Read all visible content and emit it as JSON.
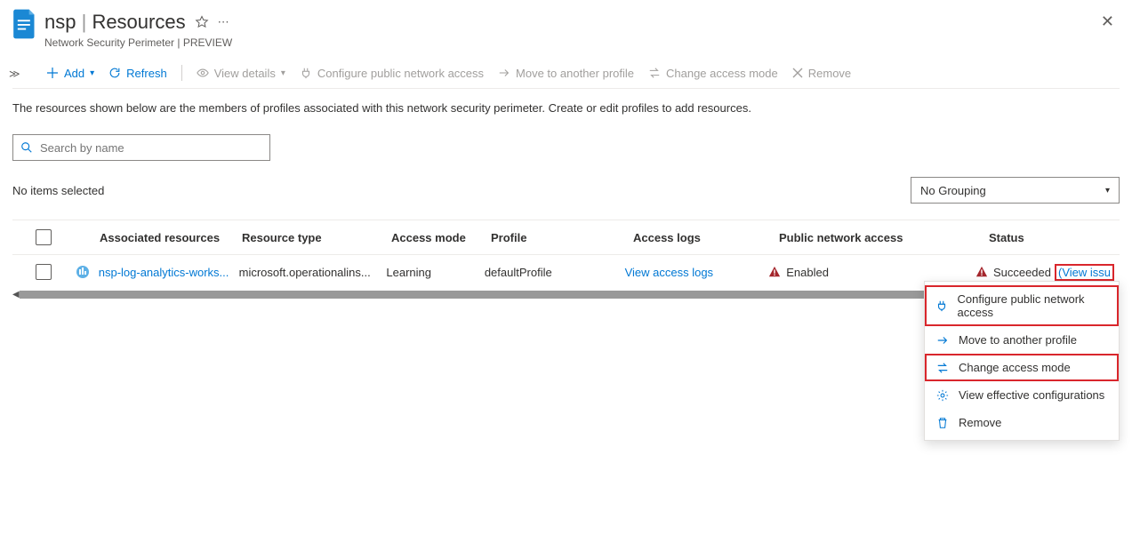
{
  "header": {
    "resource_name": "nsp",
    "page_name": "Resources",
    "subtitle": "Network Security Perimeter | PREVIEW"
  },
  "toolbar": {
    "add": "Add",
    "refresh": "Refresh",
    "view_details": "View details",
    "configure_pna": "Configure public network access",
    "move_profile": "Move to another profile",
    "change_mode": "Change access mode",
    "remove": "Remove"
  },
  "body": {
    "description": "The resources shown below are the members of profiles associated with this network security perimeter. Create or edit profiles to add resources.",
    "search_placeholder": "Search by name",
    "selection_text": "No items selected",
    "grouping_value": "No Grouping"
  },
  "columns": {
    "c1": "Associated resources",
    "c2": "Resource type",
    "c3": "Access mode",
    "c4": "Profile",
    "c5": "Access logs",
    "c6": "Public network access",
    "c7": "Status"
  },
  "row": {
    "name": "nsp-log-analytics-works...",
    "type": "microsoft.operationalins...",
    "mode": "Learning",
    "profile": "defaultProfile",
    "logs": "View access logs",
    "pna": "Enabled",
    "status": "Succeeded",
    "issues": "(View issu"
  },
  "menu": {
    "m1": "Configure public network access",
    "m2": "Move to another profile",
    "m3": "Change access mode",
    "m4": "View effective configurations",
    "m5": "Remove"
  }
}
